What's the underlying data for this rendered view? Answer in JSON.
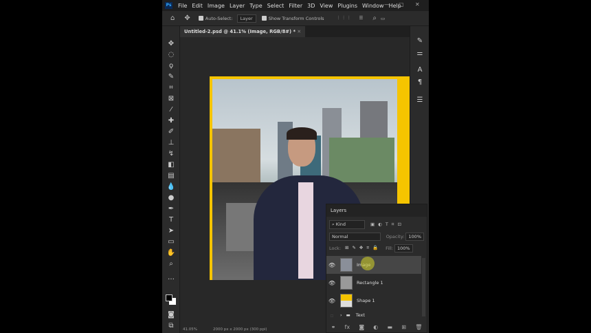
{
  "app": {
    "logo": "Ps",
    "menu": [
      "File",
      "Edit",
      "Image",
      "Layer",
      "Type",
      "Select",
      "Filter",
      "3D",
      "View",
      "Plugins",
      "Window",
      "Help"
    ]
  },
  "options": {
    "auto_select_label": "Auto-Select:",
    "auto_select_target": "Layer",
    "show_transform_label": "Show Transform Controls"
  },
  "document": {
    "tab_title": "Untitled-2.psd @ 41.1% (Image, RGB/8#) *",
    "zoom": "41.05%",
    "dimensions": "2000 px x 2000 px (300 ppi)",
    "canvas_accent": "#f5c400"
  },
  "layers_panel": {
    "title": "Layers",
    "filter": "Kind",
    "blend_mode": "Normal",
    "opacity_label": "Opacity:",
    "opacity": "100%",
    "lock_label": "Lock:",
    "fill_label": "Fill:",
    "fill": "100%",
    "layers": [
      {
        "name": "Image",
        "visible": true,
        "selected": true
      },
      {
        "name": "Rectangle 1",
        "visible": true
      },
      {
        "name": "Shape 1",
        "visible": true
      },
      {
        "name": "Text",
        "visible": false,
        "group": true
      }
    ]
  }
}
